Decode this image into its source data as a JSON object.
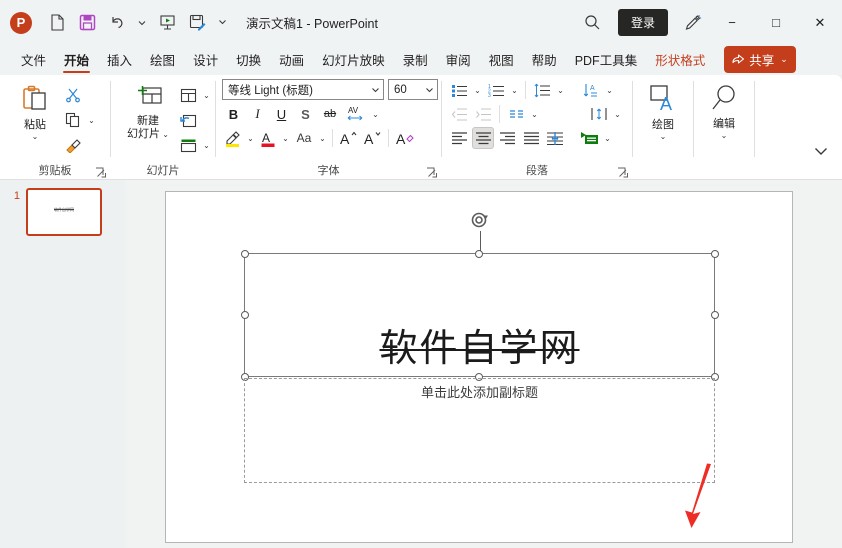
{
  "titlebar": {
    "logo_text": "P",
    "document_title": "演示文稿1  -  PowerPoint",
    "quick_access": [
      {
        "name": "new-document-icon",
        "label": "新建"
      },
      {
        "name": "save-icon",
        "label": "保存"
      },
      {
        "name": "undo-icon",
        "label": "撤消"
      },
      {
        "name": "start-slideshow-icon",
        "label": "从头开始"
      },
      {
        "name": "save-as-icon",
        "label": "另存为"
      },
      {
        "name": "customize-qat-icon",
        "label": "自定义快速访问工具栏"
      }
    ],
    "search_icon": "search-icon",
    "signin_label": "登录",
    "pen_icon": "pen-icon",
    "minimize": "−",
    "maximize": "□",
    "close": "✕"
  },
  "tabs": [
    {
      "label": "文件",
      "active": false
    },
    {
      "label": "开始",
      "active": true
    },
    {
      "label": "插入",
      "active": false
    },
    {
      "label": "绘图",
      "active": false
    },
    {
      "label": "设计",
      "active": false
    },
    {
      "label": "切换",
      "active": false
    },
    {
      "label": "动画",
      "active": false
    },
    {
      "label": "幻灯片放映",
      "active": false
    },
    {
      "label": "录制",
      "active": false
    },
    {
      "label": "审阅",
      "active": false
    },
    {
      "label": "视图",
      "active": false
    },
    {
      "label": "帮助",
      "active": false
    },
    {
      "label": "PDF工具集",
      "active": false
    },
    {
      "label": "形状格式",
      "active": false,
      "contextual": true
    }
  ],
  "share": {
    "label": "共享",
    "icon": "share-icon",
    "caret": "⌄",
    "color": "#c43e1c"
  },
  "ribbon": {
    "clipboard": {
      "group_label": "剪贴板",
      "paste_label": "粘贴",
      "paste_caret": "⌄",
      "cut_label": "剪切",
      "copy_label": "复制",
      "format_painter_label": "格式刷",
      "dialog_launcher": "⇲"
    },
    "slides": {
      "group_label": "幻灯片",
      "new_slide_label": "新建\n幻灯片",
      "new_slide_line1": "新建",
      "new_slide_line2": "幻灯片",
      "layout_label": "版式",
      "reset_label": "重置",
      "section_label": "节"
    },
    "font": {
      "group_label": "字体",
      "font_name": "等线 Light (标题)",
      "font_size": "60",
      "bold": "B",
      "italic": "I",
      "underline": "U",
      "shadow": "S",
      "strikethrough": "ab",
      "strikethrough_active": true,
      "char_spacing": "AV",
      "text_highlight_label": "文本突出显示颜色",
      "font_color_label": "字体颜色",
      "change_case": "Aa",
      "increase_size": "A",
      "decrease_size": "A",
      "clear_format": "A",
      "dialog_launcher": "⇲"
    },
    "paragraph": {
      "group_label": "段落",
      "bullets": "项目符号",
      "numbering": "编号",
      "line_spacing": "行距",
      "text_direction_sort": "排序",
      "decrease_indent": "减少缩进量",
      "increase_indent": "增加缩进量",
      "columns": "分栏",
      "align_left": "左对齐",
      "align_center": "居中",
      "align_right": "右对齐",
      "justify": "两端对齐",
      "align_text": "对齐文本",
      "convert_smartart": "转换为 SmartArt",
      "center_active": true,
      "dialog_launcher": "⇲"
    },
    "drawing": {
      "group_label": "",
      "label": "绘图",
      "caret": "⌄"
    },
    "editing": {
      "group_label": "",
      "label": "编辑",
      "caret": "⌄"
    },
    "collapse_caret": "⌄"
  },
  "thumbnails": [
    {
      "number": "1",
      "title": "软件自学网",
      "selected": true
    }
  ],
  "slide": {
    "title_placeholder": {
      "text": "软件自学网",
      "strikethrough": true,
      "selected": true
    },
    "subtitle_placeholder": {
      "text": "单击此处添加副标题"
    },
    "annotation": {
      "name": "red-arrow-annotation",
      "color": "#ee2d24"
    }
  }
}
